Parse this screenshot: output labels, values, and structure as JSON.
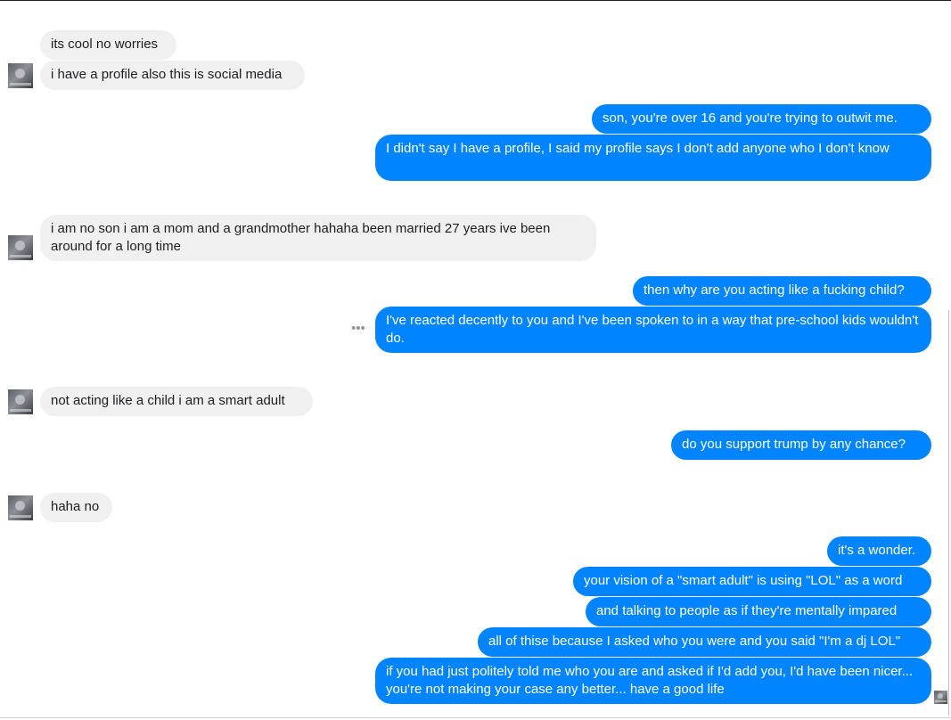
{
  "conversation": {
    "contact_avatar": "contact-avatar",
    "self_avatar": "read-receipt-avatar",
    "more_options_icon": "ellipsis-icon",
    "colors": {
      "sent_bubble": "#0084ff",
      "received_bubble": "#f1f0f0",
      "sent_text": "#ffffff",
      "received_text": "#1c1e21"
    },
    "messages": [
      {
        "sender": "them",
        "text": "its cool no worries"
      },
      {
        "sender": "them",
        "text": "i have a profile also this is social media"
      },
      {
        "sender": "me",
        "text": "son, you're over 16 and you're trying to outwit me."
      },
      {
        "sender": "me",
        "text": "I didn't say I have a profile, I said my profile says I don't add anyone who I don't know"
      },
      {
        "sender": "them",
        "text": "i am no son i am a mom and a grandmother hahaha been married 27 years ive been around for a long time"
      },
      {
        "sender": "me",
        "text": "then why are you acting like a fucking child?"
      },
      {
        "sender": "me",
        "text": "I've reacted decently to you and I've been spoken to in a way that pre-school kids wouldn't do."
      },
      {
        "sender": "them",
        "text": "not acting like a child i am a smart adult"
      },
      {
        "sender": "me",
        "text": "do you support trump by any chance?"
      },
      {
        "sender": "them",
        "text": "haha no"
      },
      {
        "sender": "me",
        "text": "it's a wonder."
      },
      {
        "sender": "me",
        "text": "your vision of a \"smart adult\" is using \"LOL\" as a word"
      },
      {
        "sender": "me",
        "text": "and talking to people as if they're mentally impared"
      },
      {
        "sender": "me",
        "text": "all of thise because I asked who you were and you said \"I'm a dj LOL\""
      },
      {
        "sender": "me",
        "text": "if you had just politely told me who you are and asked if I'd add you, I'd have been nicer... you're not making your case any better... have a good life"
      }
    ]
  }
}
